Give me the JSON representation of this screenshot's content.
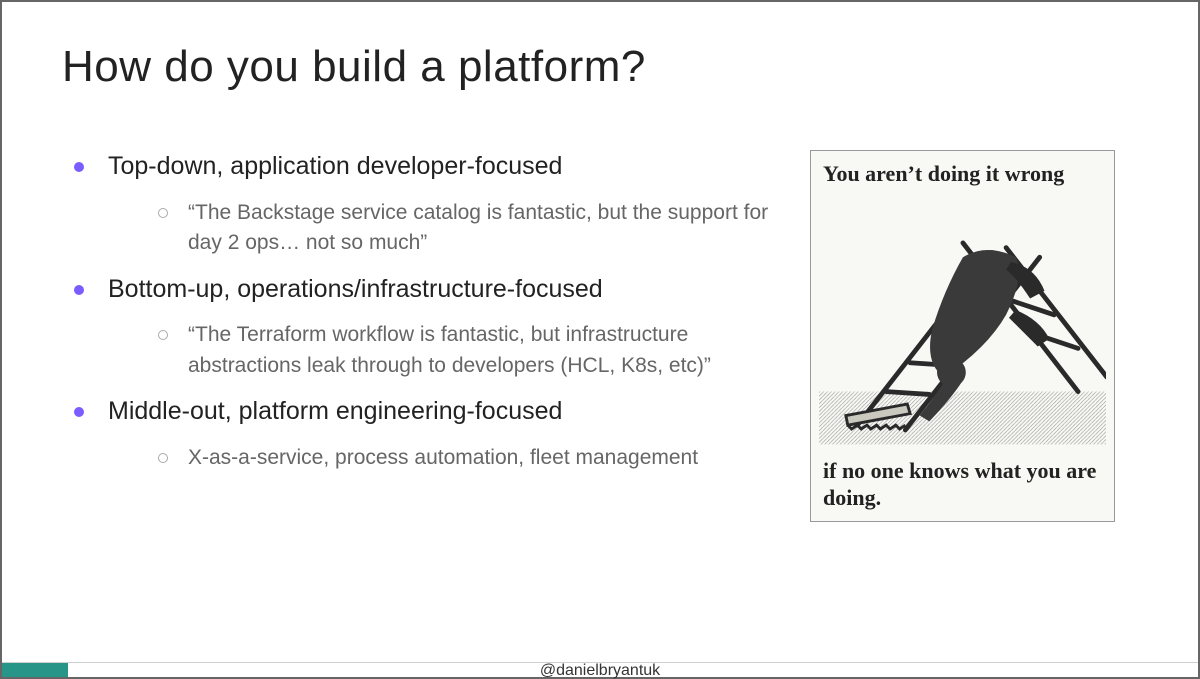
{
  "title": "How do you build a platform?",
  "bullets": [
    {
      "heading": "Top-down, application developer-focused",
      "sub": "“The Backstage service catalog is fantastic, but the support for day 2 ops… not so much”"
    },
    {
      "heading": "Bottom-up, operations/infrastructure-focused",
      "sub": "“The Terraform workflow is fantastic, but infrastructure abstractions leak through to developers (HCL, K8s, etc)”"
    },
    {
      "heading": "Middle-out, platform engineering-focused",
      "sub": "X-as-a-service, process automation, fleet management"
    }
  ],
  "meme": {
    "top": "You aren’t doing it wrong",
    "bottom": "if no one knows what you are doing."
  },
  "handle": "@danielbryantuk"
}
